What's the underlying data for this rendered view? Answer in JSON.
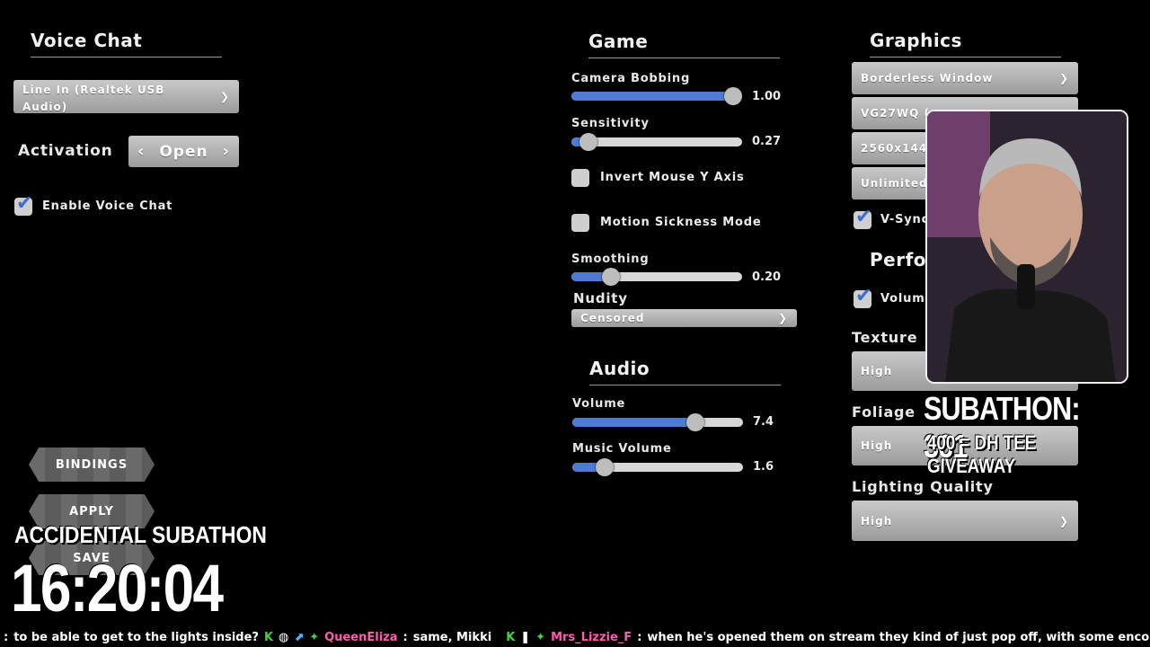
{
  "voice": {
    "title": "Voice Chat",
    "device": "Line In (Realtek USB Audio)",
    "activation_label": "Activation",
    "activation_value": "Open",
    "enable_label": "Enable Voice Chat"
  },
  "game": {
    "title": "Game",
    "camera_bobbing": {
      "label": "Camera Bobbing",
      "value": "1.00",
      "fraction": 1.0
    },
    "sensitivity": {
      "label": "Sensitivity",
      "value": "0.27",
      "fraction": 0.1
    },
    "invert_label": "Invert Mouse Y Axis",
    "motion_label": "Motion Sickness Mode",
    "smoothing": {
      "label": "Smoothing",
      "value": "0.20",
      "fraction": 0.23
    },
    "nudity_label": "Nudity",
    "nudity_value": "Censored"
  },
  "audio": {
    "title": "Audio",
    "volume": {
      "label": "Volume",
      "value": "7.4",
      "fraction": 0.72
    },
    "music": {
      "label": "Music Volume",
      "value": "1.6",
      "fraction": 0.19
    }
  },
  "graphics": {
    "title": "Graphics",
    "window_mode": "Borderless Window",
    "monitor": "VG27WQ (",
    "resolution": "2560x144",
    "fps": "Unlimited",
    "vsync_label": "V-Sync",
    "perf_title": "Perfor",
    "volum_label": "Volum",
    "texture_label": "Texture",
    "texture_value": "High",
    "foliage_label": "Foliage",
    "foliage_value": "High",
    "lighting_label": "Lighting Quality",
    "lighting_value": "High"
  },
  "buttons": {
    "bindings": "BINDINGS",
    "apply": "APPLY",
    "save": "SAVE"
  },
  "overlay": {
    "subathon": "SUBATHON: 361",
    "giveaway": "400 = DH TEE GIVEAWAY",
    "accidental": "ACCIDENTAL SUBATHON",
    "timer": "16:20:04"
  },
  "chat": {
    "line1_text": "to be able to get to the lights inside?",
    "user2": "QueenEliza",
    "text2": "same, Mikki",
    "user3": "Mrs_Lizzie_F",
    "text3": "when he's opened them on stream they kind of just pop off, with some encouraging"
  }
}
